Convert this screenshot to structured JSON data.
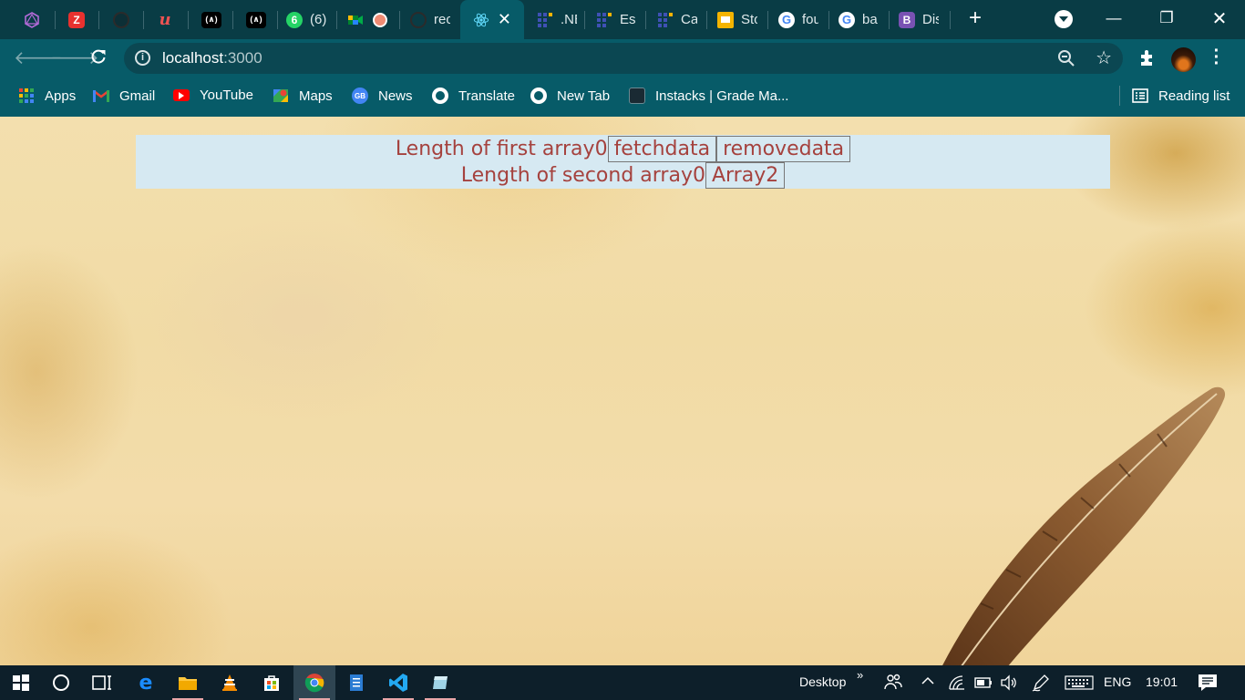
{
  "browser": {
    "tabs": [
      {
        "label": "",
        "icon": "graphql-icon"
      },
      {
        "label": "",
        "icon": "zoho-icon",
        "letter": "Z"
      },
      {
        "label": "",
        "icon": "github-icon"
      },
      {
        "label": "",
        "icon": "udemy-icon",
        "letter": "u"
      },
      {
        "label": "",
        "icon": "codepen-icon",
        "letter": "(∧)"
      },
      {
        "label": "",
        "icon": "codepen-icon",
        "letter": "(∧)"
      },
      {
        "label": "(6)",
        "icon": "whatsapp-icon",
        "letter": "6"
      },
      {
        "label": "",
        "icon": "google-meet-icon"
      },
      {
        "label": "rec",
        "icon": "github-icon"
      },
      {
        "label": "",
        "icon": "react-icon",
        "active": true
      },
      {
        "label": ".NE",
        "icon": "dashboard-icon"
      },
      {
        "label": "Ess",
        "icon": "dashboard-icon"
      },
      {
        "label": "Ca",
        "icon": "dashboard-icon"
      },
      {
        "label": "Sto",
        "icon": "slides-icon"
      },
      {
        "label": "fou",
        "icon": "google-icon",
        "letter": "G"
      },
      {
        "label": "ba",
        "icon": "google-icon",
        "letter": "G"
      },
      {
        "label": "Dis",
        "icon": "bootstrap-icon",
        "letter": "B"
      }
    ],
    "address": {
      "host": "localhost",
      "port": ":3000"
    },
    "bookmarks": [
      {
        "label": "Apps",
        "icon": "apps-grid-icon"
      },
      {
        "label": "Gmail",
        "icon": "gmail-icon"
      },
      {
        "label": "YouTube",
        "icon": "youtube-icon"
      },
      {
        "label": "Maps",
        "icon": "maps-icon"
      },
      {
        "label": "News",
        "icon": "news-icon"
      },
      {
        "label": "Translate",
        "icon": "globe-icon"
      },
      {
        "label": "New Tab",
        "icon": "globe-icon"
      },
      {
        "label": "Instacks | Grade Ma...",
        "icon": "instacks-icon"
      }
    ],
    "reading_list": "Reading list"
  },
  "app": {
    "first_label": "Length of first array ",
    "first_count": "0",
    "fetch_button": "fetchdata",
    "remove_button": "removedata",
    "second_label": "Length of second array ",
    "second_count": "0",
    "array2_button": "Array2",
    "text_color": "#a5423e",
    "panel_color": "#d6e9f2"
  },
  "taskbar": {
    "desktop_label": "Desktop",
    "language": "ENG",
    "time": "19:01"
  }
}
